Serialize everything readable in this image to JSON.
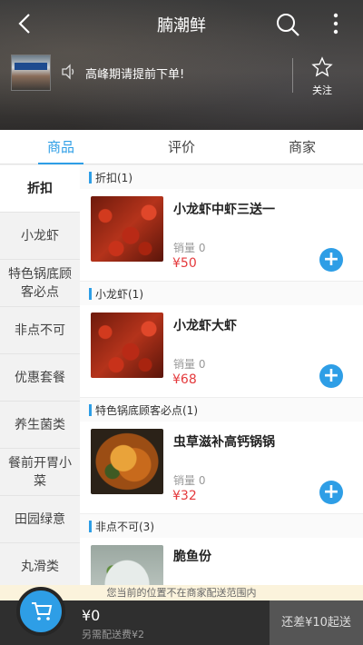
{
  "header": {
    "title": "腩潮鲜",
    "notice": "高峰期请提前下单!",
    "follow_label": "关注"
  },
  "tabs": [
    {
      "label": "商品",
      "active": true
    },
    {
      "label": "评价",
      "active": false
    },
    {
      "label": "商家",
      "active": false
    }
  ],
  "sidebar": {
    "items": [
      {
        "label": "折扣",
        "active": true
      },
      {
        "label": "小龙虾",
        "active": false
      },
      {
        "label": "特色锅底顾客必点",
        "active": false
      },
      {
        "label": "非点不可",
        "active": false
      },
      {
        "label": "优惠套餐",
        "active": false
      },
      {
        "label": "养生菌类",
        "active": false
      },
      {
        "label": "餐前开胃小菜",
        "active": false
      },
      {
        "label": "田园绿意",
        "active": false
      },
      {
        "label": "丸滑类",
        "active": false
      }
    ]
  },
  "sections": [
    {
      "header": "折扣(1)",
      "items": [
        {
          "name": "小龙虾中虾三送一",
          "sales": "销量 0",
          "price": "¥50",
          "image": "crayfish"
        }
      ]
    },
    {
      "header": "小龙虾(1)",
      "items": [
        {
          "name": "小龙虾大虾",
          "sales": "销量 0",
          "price": "¥68",
          "image": "crayfish"
        }
      ]
    },
    {
      "header": "特色锅底顾客必点(1)",
      "items": [
        {
          "name": "虫草滋补高钙锅锅",
          "sales": "销量 0",
          "price": "¥32",
          "image": "pot"
        }
      ]
    },
    {
      "header": "非点不可(3)",
      "items": [
        {
          "name": "脆鱼份",
          "sales": "",
          "price": "",
          "image": "fish"
        }
      ]
    }
  ],
  "location_notice": "您当前的位置不在商家配送范围内",
  "cart": {
    "total": "¥0",
    "delivery_fee": "另需配送费¥2",
    "checkout_label": "还差¥10起送"
  },
  "colors": {
    "accent": "#2e9ee6",
    "price": "#e4393c",
    "bottom_bar": "#2f2f2f"
  },
  "icons": [
    "back-arrow-icon",
    "search-icon",
    "more-vertical-icon",
    "speaker-icon",
    "star-icon",
    "plus-icon",
    "cart-icon"
  ]
}
